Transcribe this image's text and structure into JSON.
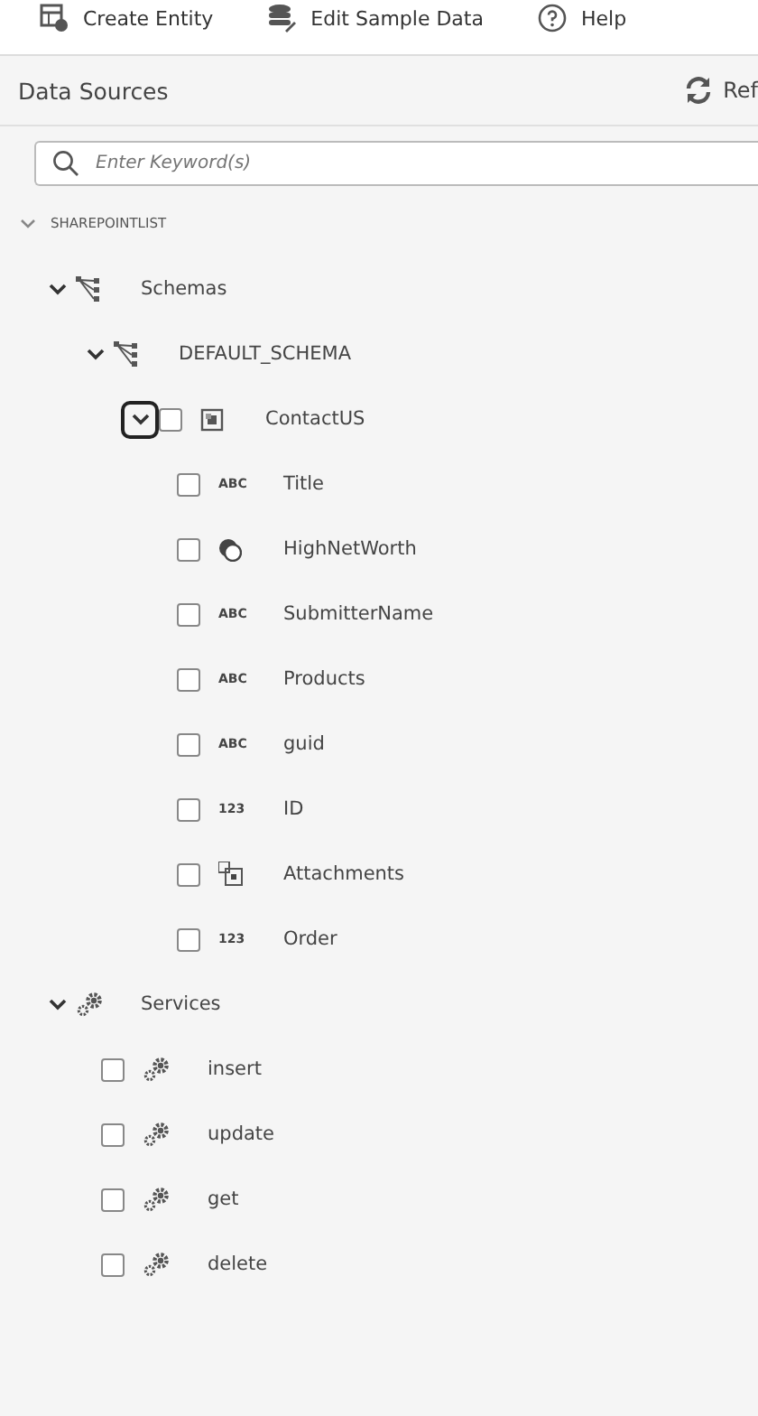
{
  "toolbar": [
    {
      "label": "Create Entity",
      "kind": "create"
    },
    {
      "label": "Edit Sample Data",
      "kind": "data"
    },
    {
      "label": "Help",
      "kind": "help"
    }
  ],
  "panel": {
    "title": "Data Sources",
    "refresh_label": "Ref"
  },
  "search": {
    "placeholder": "Enter Keyword(s)"
  },
  "tree": {
    "label": "SHAREPOINTLIST",
    "expanded": true,
    "children": [
      {
        "label": "Schemas",
        "kind": "schema",
        "expanded": true,
        "children": [
          {
            "label": "DEFAULT_SCHEMA",
            "kind": "schema",
            "expanded": true,
            "children": [
              {
                "label": "ContactUS",
                "kind": "entity",
                "expanded": true,
                "focused": true,
                "checked": false,
                "children": [
                  {
                    "label": "Title",
                    "kind": "text",
                    "badge": "ABC",
                    "checked": false
                  },
                  {
                    "label": "HighNetWorth",
                    "kind": "boolean",
                    "checked": false
                  },
                  {
                    "label": "SubmitterName",
                    "kind": "text",
                    "badge": "ABC",
                    "checked": false
                  },
                  {
                    "label": "Products",
                    "kind": "text",
                    "badge": "ABC",
                    "checked": false
                  },
                  {
                    "label": "guid",
                    "kind": "text",
                    "badge": "ABC",
                    "checked": false
                  },
                  {
                    "label": "ID",
                    "kind": "text",
                    "badge": "123",
                    "checked": false
                  },
                  {
                    "label": "Attachments",
                    "kind": "attachment",
                    "checked": false
                  },
                  {
                    "label": "Order",
                    "kind": "text",
                    "badge": "123",
                    "checked": false
                  }
                ]
              }
            ]
          }
        ]
      },
      {
        "label": "Services",
        "kind": "service",
        "expanded": true,
        "children": [
          {
            "label": "insert",
            "kind": "service",
            "checked": false
          },
          {
            "label": "update",
            "kind": "service",
            "checked": false
          },
          {
            "label": "get",
            "kind": "service",
            "checked": false
          },
          {
            "label": "delete",
            "kind": "service",
            "checked": false
          }
        ]
      }
    ]
  }
}
